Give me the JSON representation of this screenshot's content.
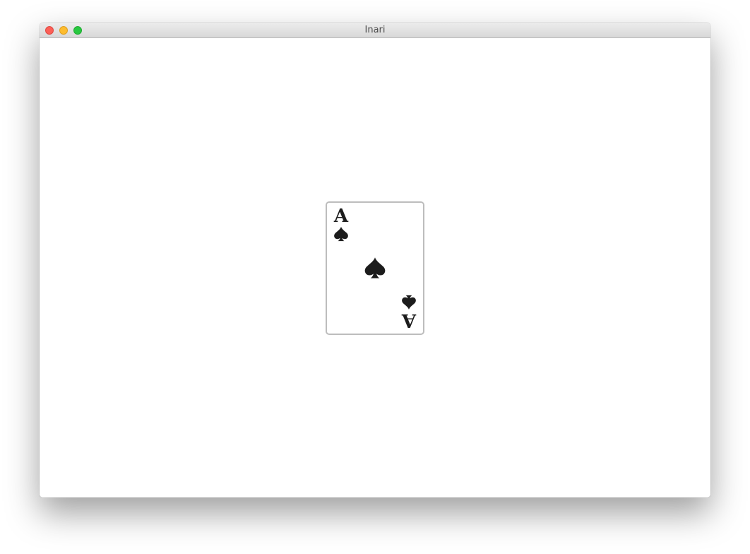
{
  "window": {
    "title": "Inari"
  },
  "card": {
    "rank": "A",
    "suit": "spades",
    "suit_icon": "spade-icon",
    "color": "#1c1c1c"
  },
  "colors": {
    "close": "#fc5f57",
    "minimize": "#fdbc2e",
    "zoom": "#28c840",
    "card_border": "#bdbdbd"
  }
}
